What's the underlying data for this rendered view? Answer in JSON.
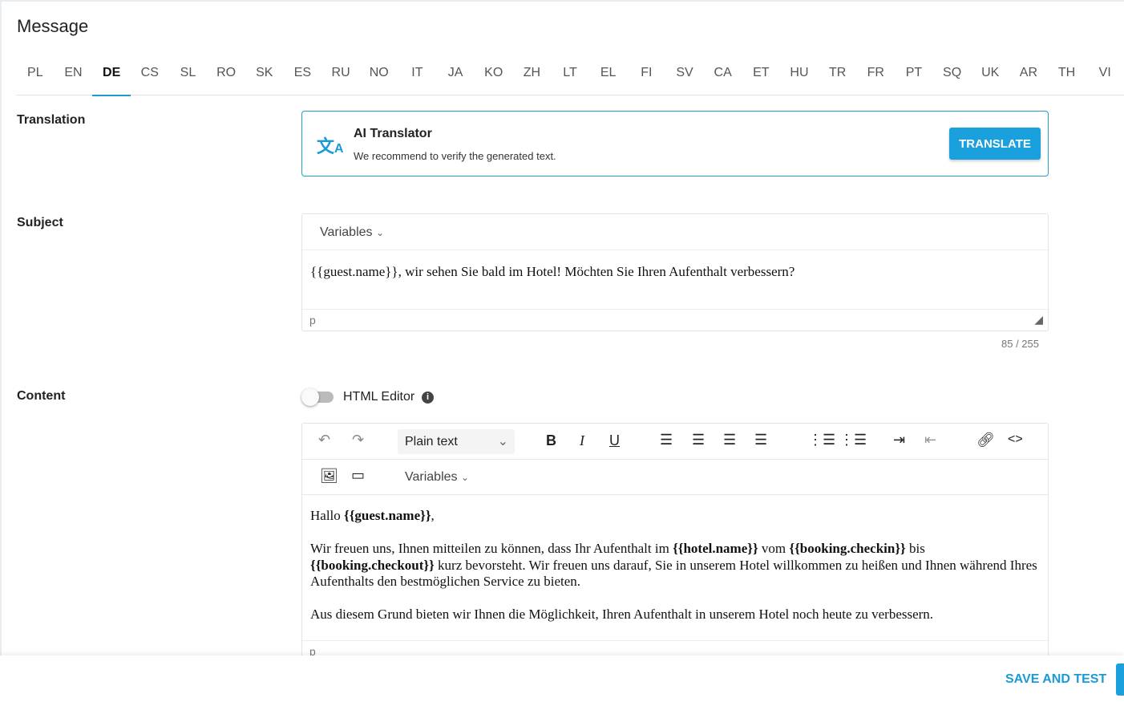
{
  "header": {
    "title": "Message"
  },
  "tabs": [
    "PL",
    "EN",
    "DE",
    "CS",
    "SL",
    "RO",
    "SK",
    "ES",
    "RU",
    "NO",
    "IT",
    "JA",
    "KO",
    "ZH",
    "LT",
    "EL",
    "FI",
    "SV",
    "CA",
    "ET",
    "HU",
    "TR",
    "FR",
    "PT",
    "SQ",
    "UK",
    "AR",
    "TH",
    "VI"
  ],
  "active_tab": "DE",
  "translation": {
    "label": "Translation",
    "title": "AI Translator",
    "subtitle": "We recommend to verify the generated text.",
    "button": "TRANSLATE",
    "icon": "translate-icon"
  },
  "subject": {
    "label": "Subject",
    "variables": "Variables",
    "value": "{{guest.name}}, wir sehen Sie bald im Hotel! Möchten Sie Ihren Aufenthalt verbessern?",
    "path": "p",
    "count": "85 / 255"
  },
  "content": {
    "label": "Content",
    "html_editor_label": "HTML Editor",
    "html_editor_on": false,
    "format": "Plain text",
    "variables": "Variables",
    "path": "p",
    "body": [
      [
        {
          "t": "Hallo "
        },
        {
          "t": "{{guest.name}}",
          "b": true
        },
        {
          "t": ","
        }
      ],
      [
        {
          "t": "Wir freuen uns, Ihnen mitteilen zu können, dass Ihr Aufenthalt im "
        },
        {
          "t": "{{hotel.name}}",
          "b": true
        },
        {
          "t": " vom "
        },
        {
          "t": "{{booking.checkin}}",
          "b": true
        },
        {
          "t": " bis "
        },
        {
          "t": "{{booking.checkout}}",
          "b": true
        },
        {
          "t": " kurz bevorsteht. Wir freuen uns darauf, Sie in unserem Hotel willkommen zu heißen und Ihnen während Ihres Aufenthalts den bestmöglichen Service zu bieten."
        }
      ],
      [
        {
          "t": "Aus diesem Grund bieten wir Ihnen die Möglichkeit, Ihren Aufenthalt in unserem Hotel noch heute zu verbessern."
        }
      ]
    ]
  },
  "footer": {
    "save_and_test": "SAVE AND TEST"
  },
  "colors": {
    "accent": "#1a9ad6"
  }
}
